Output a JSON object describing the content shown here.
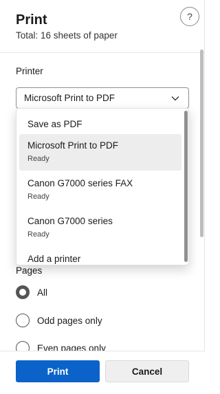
{
  "header": {
    "title": "Print",
    "subtitle": "Total: 16 sheets of paper",
    "help_label": "?"
  },
  "printer": {
    "label": "Printer",
    "selected": "Microsoft Print to PDF",
    "options": [
      {
        "name": "Save as PDF",
        "status": ""
      },
      {
        "name": "Microsoft Print to PDF",
        "status": "Ready"
      },
      {
        "name": "Canon G7000 series FAX",
        "status": "Ready"
      },
      {
        "name": "Canon G7000 series",
        "status": "Ready"
      },
      {
        "name": "Add a printer",
        "status": ""
      }
    ]
  },
  "pages": {
    "label": "Pages",
    "options": [
      {
        "label": "All",
        "checked": true
      },
      {
        "label": "Odd pages only",
        "checked": false
      },
      {
        "label": "Even pages only",
        "checked": false
      }
    ]
  },
  "footer": {
    "print_label": "Print",
    "cancel_label": "Cancel"
  },
  "colors": {
    "accent": "#0b63c9",
    "selected_bg": "#ededed"
  }
}
